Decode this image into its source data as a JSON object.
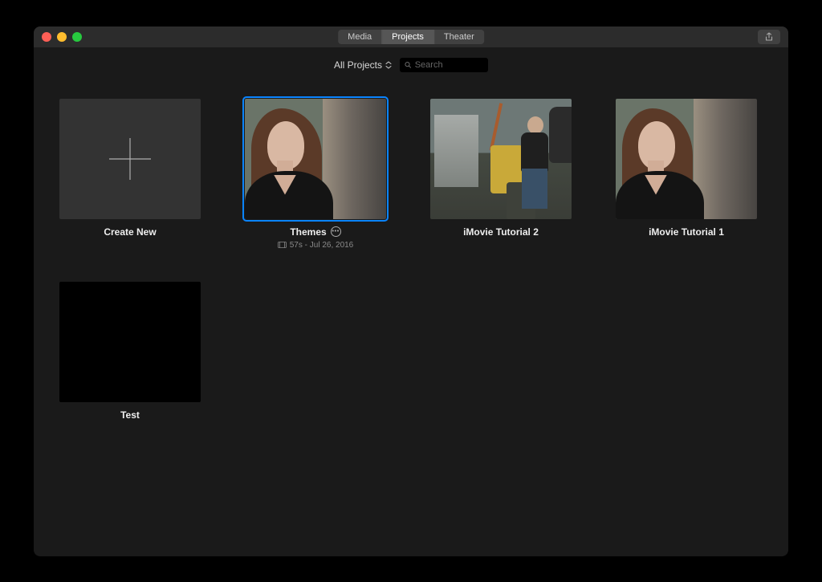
{
  "titlebar": {
    "tabs": {
      "media": "Media",
      "projects": "Projects",
      "theater": "Theater"
    }
  },
  "toolbar": {
    "filter_label": "All Projects",
    "search_placeholder": "Search"
  },
  "items": {
    "create_new": "Create New",
    "themes": {
      "title": "Themes",
      "meta": "57s - Jul 26, 2016"
    },
    "tutorial2": "iMovie Tutorial 2",
    "tutorial1": "iMovie Tutorial 1",
    "test": "Test"
  }
}
